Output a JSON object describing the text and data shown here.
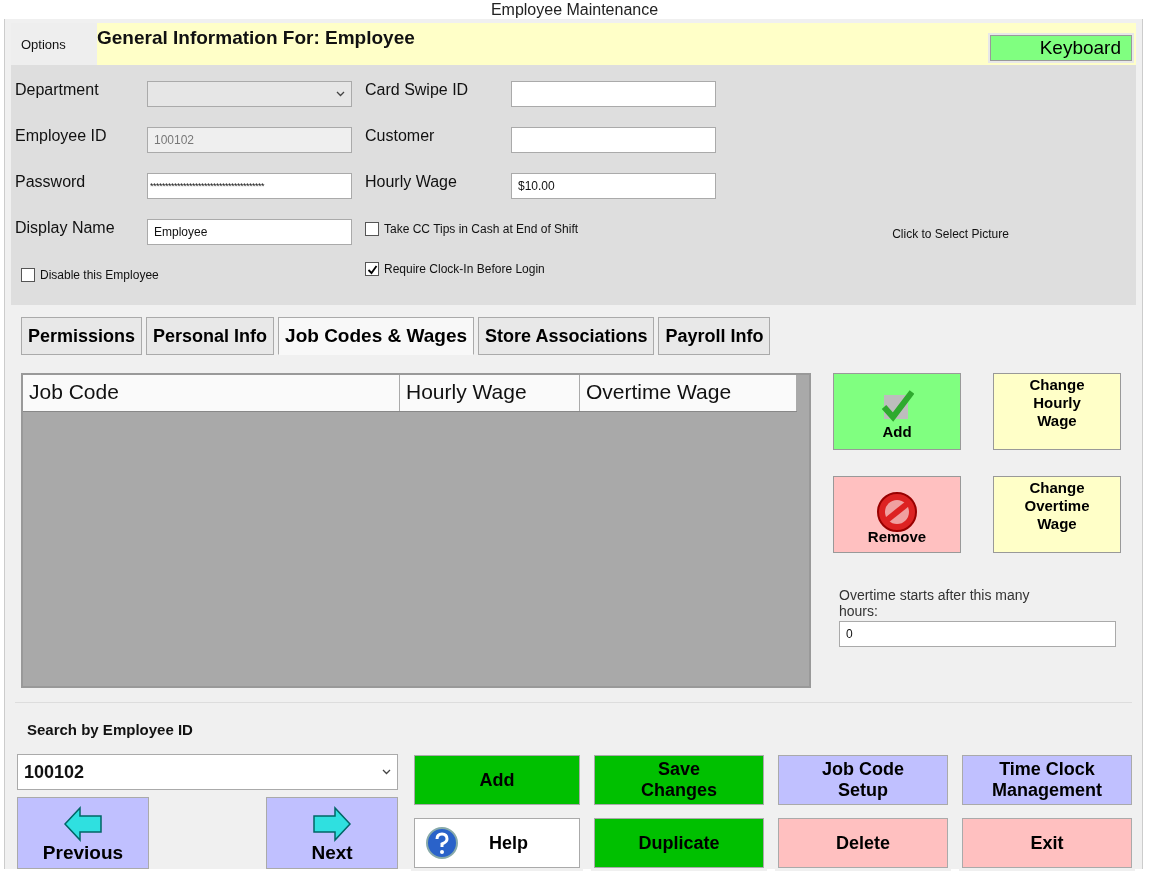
{
  "window": {
    "title": "Employee Maintenance"
  },
  "options_menu": "Options",
  "header": {
    "title": "General Information For: Employee",
    "keyboard_button": "Keyboard"
  },
  "fields_left": [
    {
      "kind": "select",
      "label": "Department"
    },
    {
      "kind": "text",
      "label": "Employee ID",
      "value": "100102",
      "disabled": true
    },
    {
      "kind": "password",
      "label": "Password",
      "value": "**************************************"
    },
    {
      "kind": "text",
      "label": "Display Name",
      "value": "Employee"
    },
    {
      "kind": "checkbox",
      "label": "Disable this Employee",
      "checked": false
    }
  ],
  "fields_right": [
    {
      "kind": "text",
      "label": "Card Swipe ID"
    },
    {
      "kind": "text",
      "label": "Customer"
    },
    {
      "kind": "text",
      "label": "Hourly Wage",
      "value": "$10.00"
    },
    {
      "kind": "checkbox",
      "label": "Take CC Tips in Cash at End of Shift",
      "checked": false
    },
    {
      "kind": "checkbox",
      "label": "Require Clock-In Before Login",
      "checked": true
    }
  ],
  "picture_prompt": "Click to Select Picture",
  "tabs": [
    {
      "label": "Permissions",
      "selected": false
    },
    {
      "label": "Personal Info",
      "selected": false
    },
    {
      "label": "Job Codes & Wages",
      "selected": true
    },
    {
      "label": "Store Associations",
      "selected": false
    },
    {
      "label": "Payroll Info",
      "selected": false
    }
  ],
  "table": {
    "columns": [
      "Job Code",
      "Hourly Wage",
      "Overtime Wage"
    ]
  },
  "wage_buttons": [
    {
      "kind": "add",
      "label": "Add"
    },
    {
      "kind": "change",
      "label": "Change Hourly Wage"
    },
    {
      "kind": "remove",
      "label": "Remove"
    },
    {
      "kind": "change",
      "label": "Change Overtime Wage"
    }
  ],
  "overtime": {
    "label": "Overtime starts after this many hours:",
    "value": "0"
  },
  "search": {
    "label": "Search by Employee ID",
    "value": "100102"
  },
  "nav_buttons": [
    {
      "kind": "previous",
      "label": "Previous"
    },
    {
      "kind": "next",
      "label": "Next"
    }
  ],
  "actions": [
    {
      "kind": "green",
      "label": "Add"
    },
    {
      "kind": "green",
      "label": "Save Changes"
    },
    {
      "kind": "blue",
      "label": "Job Code Setup"
    },
    {
      "kind": "blue",
      "label": "Time Clock Management"
    },
    {
      "kind": "help",
      "label": "Help"
    },
    {
      "kind": "green",
      "label": "Duplicate"
    },
    {
      "kind": "red",
      "label": "Delete"
    },
    {
      "kind": "red",
      "label": "Exit"
    }
  ]
}
